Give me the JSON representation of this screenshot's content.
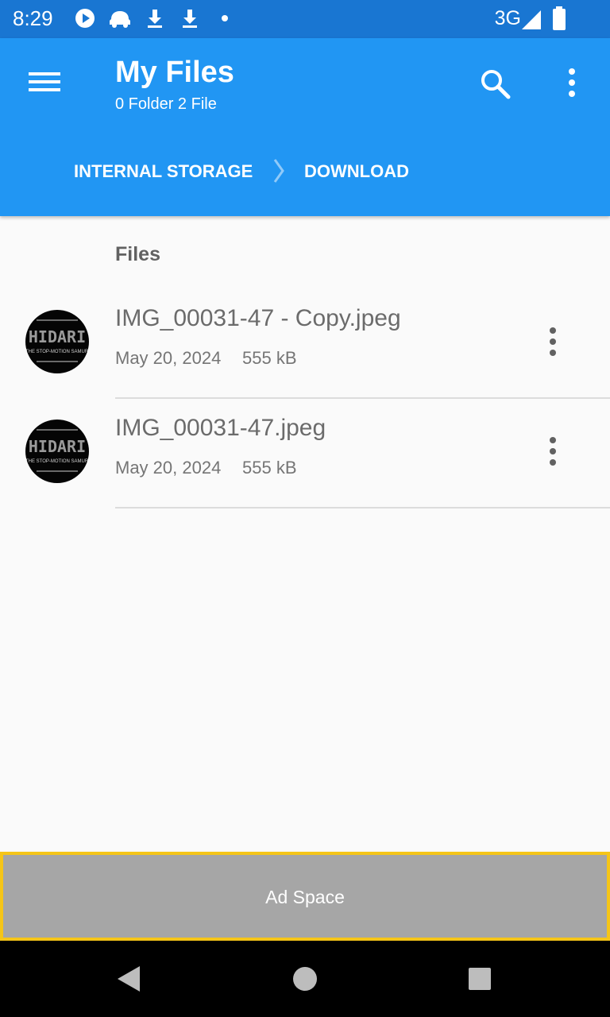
{
  "status_bar": {
    "time": "8:29",
    "network": "3G",
    "icons": [
      "play-icon",
      "car-icon",
      "download-icon",
      "download-icon",
      "dot-icon",
      "signal-icon",
      "battery-icon"
    ]
  },
  "app_bar": {
    "title": "My Files",
    "subtitle": "0 Folder 2 File",
    "breadcrumb": [
      "INTERNAL STORAGE",
      "DOWNLOAD"
    ],
    "icons": [
      "menu-icon",
      "search-icon",
      "more-vert-icon"
    ]
  },
  "content": {
    "section_header": "Files",
    "files": [
      {
        "name": "IMG_00031-47 - Copy.jpeg",
        "date": "May 20, 2024",
        "size": "555 kB",
        "thumbnail_text": "HIDARI",
        "thumbnail_subtext": "THE STOP-MOTION SAMURAI FILM"
      },
      {
        "name": "IMG_00031-47.jpeg",
        "date": "May 20, 2024",
        "size": "555 kB",
        "thumbnail_text": "HIDARI",
        "thumbnail_subtext": "THE STOP-MOTION SAMURAI FILM"
      }
    ]
  },
  "ad": {
    "label": "Ad Space"
  },
  "nav_bar": {
    "icons": [
      "back-icon",
      "home-icon",
      "recents-icon"
    ]
  },
  "colors": {
    "status_bar": "#1976d2",
    "app_bar": "#2196f3",
    "background": "#fafafa",
    "ad_border": "#f5c518",
    "ad_fill": "#a6a6a6"
  }
}
